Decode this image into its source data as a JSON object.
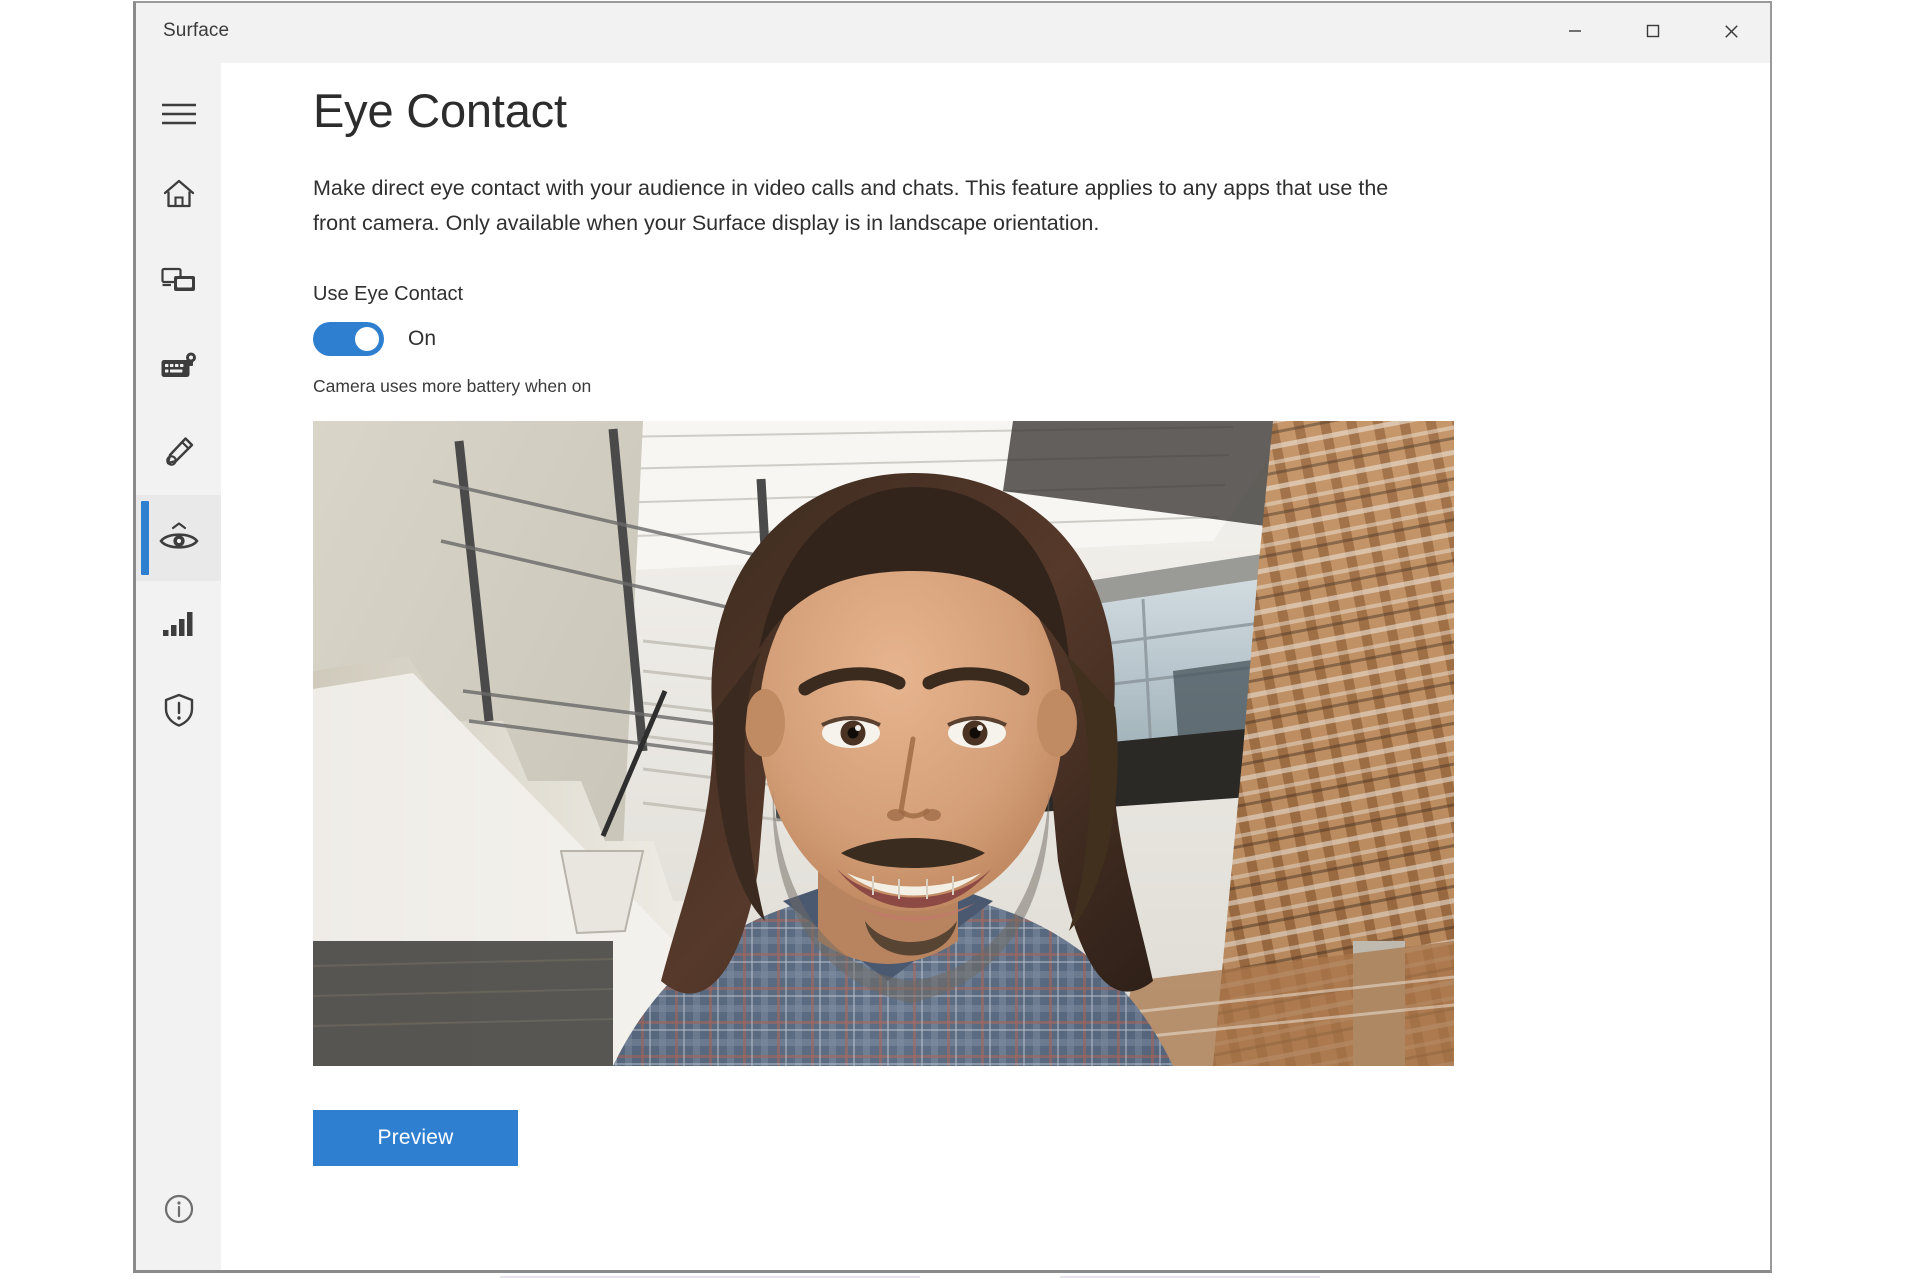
{
  "window": {
    "title": "Surface",
    "caption": {
      "minimize_label": "Minimize",
      "maximize_label": "Maximize",
      "close_label": "Close"
    }
  },
  "sidebar": {
    "items": [
      {
        "id": "menu",
        "icon": "hamburger-menu-icon",
        "label": "Menu",
        "selected": false
      },
      {
        "id": "home",
        "icon": "home-icon",
        "label": "Home",
        "selected": false
      },
      {
        "id": "devices",
        "icon": "devices-icon",
        "label": "Your Surface",
        "selected": false
      },
      {
        "id": "keyboard",
        "icon": "keyboard-pen-icon",
        "label": "Keyboard",
        "selected": false
      },
      {
        "id": "pen",
        "icon": "pen-icon",
        "label": "Pen",
        "selected": false
      },
      {
        "id": "eye",
        "icon": "eye-contact-icon",
        "label": "Eye Contact",
        "selected": true
      },
      {
        "id": "signal",
        "icon": "signal-bars-icon",
        "label": "Connections",
        "selected": false
      },
      {
        "id": "warranty",
        "icon": "shield-alert-icon",
        "label": "Warranty and service",
        "selected": false
      }
    ],
    "footer": {
      "id": "about",
      "icon": "info-circle-icon",
      "label": "About"
    }
  },
  "main": {
    "page_title": "Eye Contact",
    "description": "Make direct eye contact with your audience in video calls and chats. This feature applies to any apps that use the front camera. Only available when your Surface display is in landscape orientation.",
    "setting": {
      "label": "Use Eye Contact",
      "toggle_state": "On",
      "toggle_on": true,
      "hint": "Camera uses more battery when on"
    },
    "camera_preview": {
      "alt": "Live front camera preview showing a smiling man with long curly hair inside a modern building atrium with a staircase, glass windows and wooden slat ceiling"
    },
    "preview_button": "Preview"
  },
  "colors": {
    "accent": "#2f7fd1",
    "titlebar_bg": "#f2f2f2",
    "sidebar_bg": "#f2f2f2",
    "content_bg": "#ffffff",
    "text": "#2f2f2f",
    "close_hover": "#e81123"
  }
}
